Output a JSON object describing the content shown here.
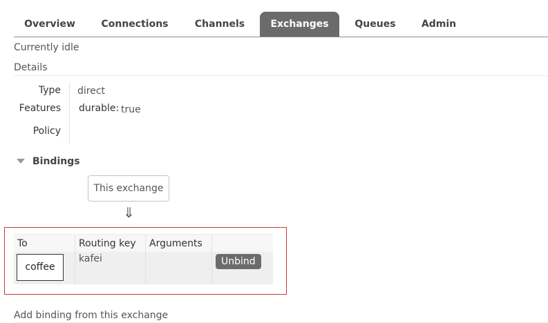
{
  "tabs": [
    {
      "label": "Overview",
      "active": false
    },
    {
      "label": "Connections",
      "active": false
    },
    {
      "label": "Channels",
      "active": false
    },
    {
      "label": "Exchanges",
      "active": true
    },
    {
      "label": "Queues",
      "active": false
    },
    {
      "label": "Admin",
      "active": false
    }
  ],
  "status": "Currently idle",
  "details": {
    "title": "Details",
    "type_label": "Type",
    "type_value": "direct",
    "features_label": "Features",
    "features_key": "durable:",
    "features_value": "true",
    "policy_label": "Policy",
    "policy_value": ""
  },
  "bindings": {
    "title": "Bindings",
    "source_box": "This exchange",
    "arrow": "⇓",
    "columns": [
      "To",
      "Routing key",
      "Arguments",
      ""
    ],
    "rows": [
      {
        "to": "coffee",
        "routing_key": "kafei",
        "arguments": "",
        "action": "Unbind"
      }
    ]
  },
  "add_binding_title": "Add binding from this exchange",
  "colors": {
    "accent": "#6b6b6b",
    "highlight_border": "#c9363a"
  }
}
